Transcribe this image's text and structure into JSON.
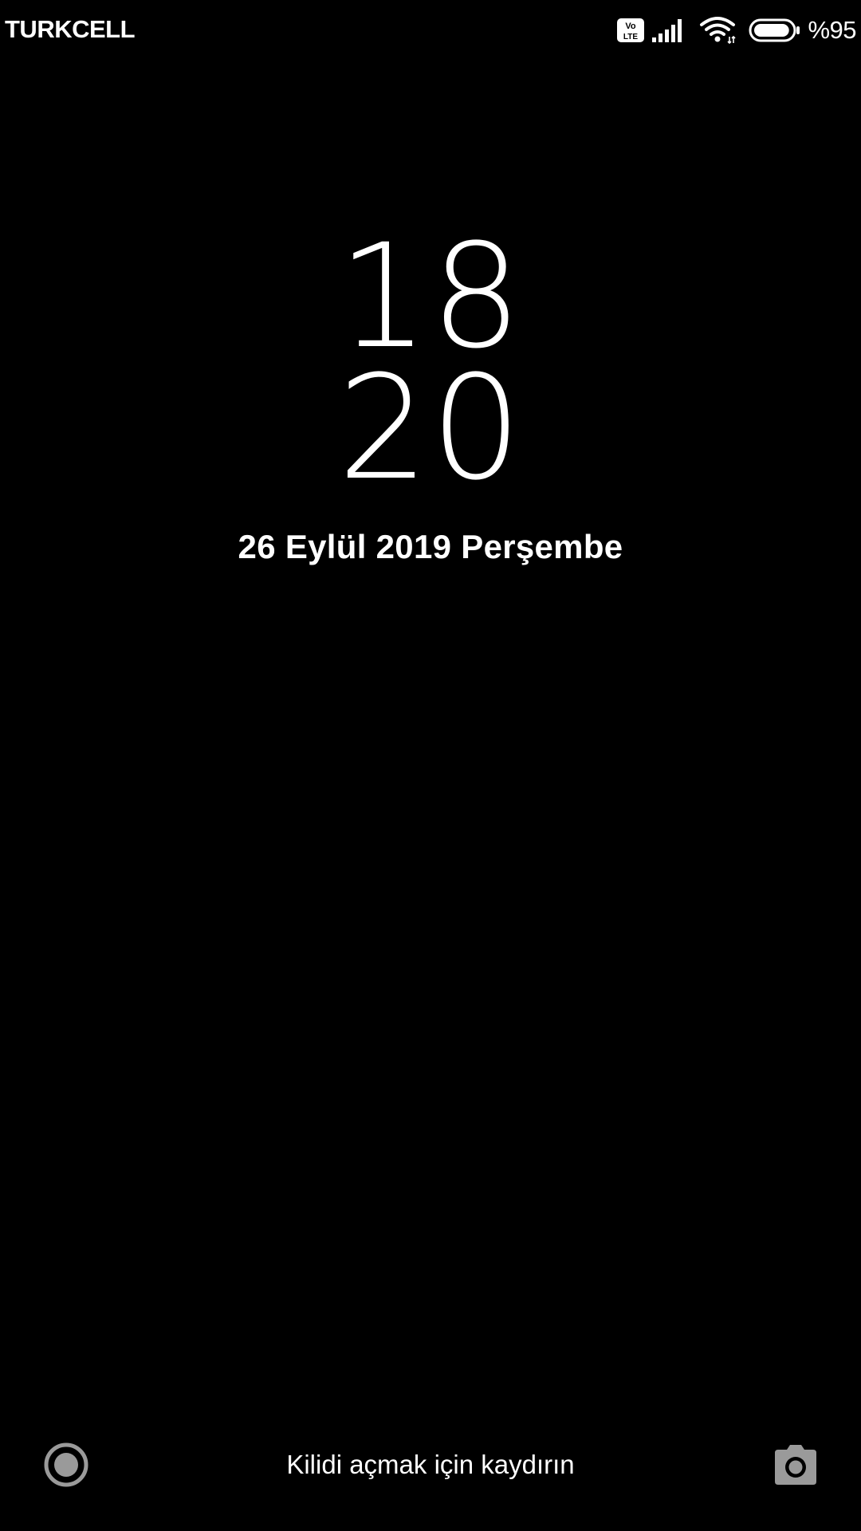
{
  "status_bar": {
    "carrier": "TURKCELL",
    "volte_badge": "Vo LTE",
    "battery_percent": "%95",
    "battery_level": 0.95
  },
  "clock": {
    "hours": "18",
    "minutes": "20"
  },
  "date": "26 Eylül 2019 Perşembe",
  "unlock_hint": "Kilidi açmak için kaydırın",
  "icons": {
    "left_shortcut": "record-circle-icon",
    "right_shortcut": "camera-icon"
  },
  "colors": {
    "background": "#000000",
    "foreground": "#ffffff",
    "shortcut_icon": "#9a9a9a"
  }
}
